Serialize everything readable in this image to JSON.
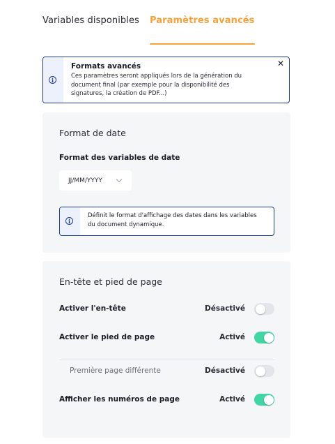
{
  "tabs": [
    {
      "label": "Variables disponibles",
      "active": false
    },
    {
      "label": "Paramètres avancés",
      "active": true
    }
  ],
  "banner": {
    "icon": "info-icon",
    "title": "Formats avancés",
    "text": "Ces paramètres seront appliqués lors de la génération du document final (par exemple pour la disponibilité des signatures, la création de PDF...)",
    "close_icon": "close-icon"
  },
  "date_section": {
    "title": "Format de date",
    "field_label": "Format des variables de date",
    "select_value": "JJ/MM/YYYY",
    "info_icon": "info-icon",
    "info_text": "Définit le format d'affichage des dates dans les variables du document dynamique."
  },
  "header_footer_section": {
    "title": "En-tête et pied de page",
    "rows": [
      {
        "label": "Activer l'en-tête",
        "status": "Désactivé",
        "on": false
      },
      {
        "label": "Activer le pied de page",
        "status": "Activé",
        "on": true
      },
      {
        "label": "Première page différente",
        "status": "Désactivé",
        "on": false
      },
      {
        "label": "Afficher les numéros de page",
        "status": "Activé",
        "on": true
      }
    ]
  },
  "colors": {
    "accent": "#f7a23b",
    "info_border": "#1d3a8a",
    "toggle_on": "#42d6a4",
    "toggle_off": "#e3e5ea",
    "section_bg": "#f5f6f8"
  }
}
